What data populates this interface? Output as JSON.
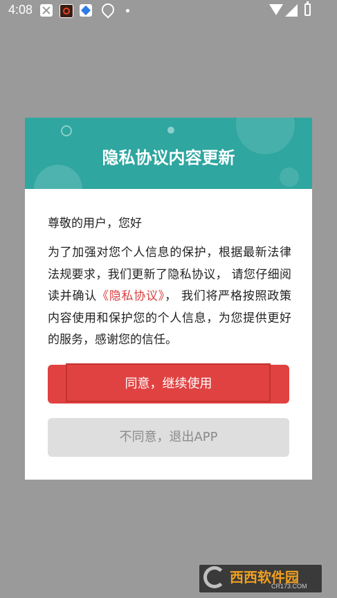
{
  "status_bar": {
    "time": "4:08",
    "icons": [
      "close-box-icon",
      "app-notification-icon",
      "app-store-icon",
      "location-icon",
      "dot-icon",
      "wifi-icon",
      "signal-icon",
      "battery-icon"
    ]
  },
  "dialog": {
    "title": "隐私协议内容更新",
    "greeting": "尊敬的用户，您好",
    "body_prefix": "为了加强对您个人信息的保护，根据最新法律法规要求，我们更新了隐私协议， 请您仔细阅读并确认",
    "link_text": "《隐私协议》",
    "body_suffix": "， 我们将严格按照政策内容使用和保护您的个人信息，为您提供更好的服务，感谢您的信任。",
    "agree_label": "同意，继续使用",
    "disagree_label": "不同意，退出APP"
  },
  "watermark": {
    "brand": "西西软件园",
    "url": "CR173.COM"
  },
  "colors": {
    "header": "#2fa6a0",
    "agree": "#e04242",
    "link": "#d94040",
    "disagree": "#dedede",
    "overlay": "#9a9a9a"
  }
}
